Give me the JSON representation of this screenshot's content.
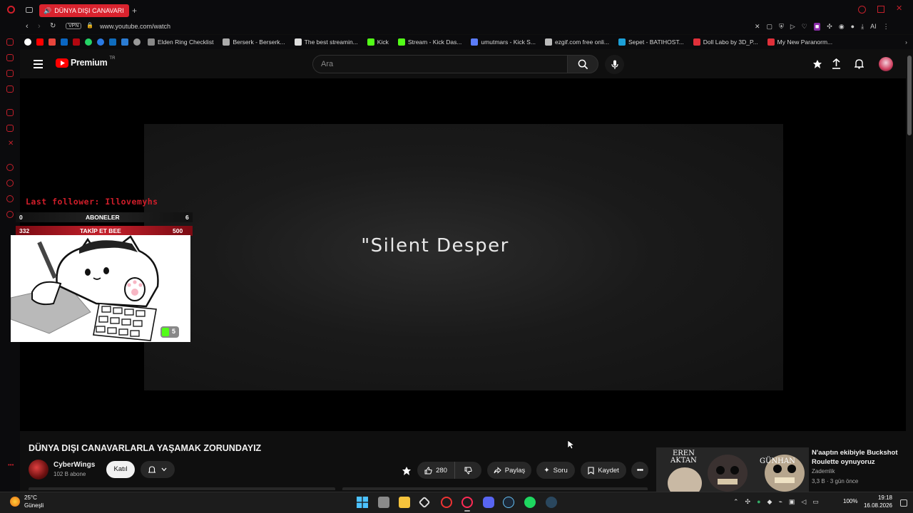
{
  "browser": {
    "tab_title": "DÜNYA DIŞI CANAVARI",
    "vpn_label": "VPN",
    "url": "www.youtube.com/watch",
    "ai_label": "AI",
    "bookmarks": [
      {
        "label": "Elden Ring Checklist",
        "color": "#888888"
      },
      {
        "label": "Berserk - Berserk...",
        "color": "#aaaaaa"
      },
      {
        "label": "The best streamin...",
        "color": "#dddddd"
      },
      {
        "label": "Kick",
        "color": "#53fc18"
      },
      {
        "label": "Stream - Kick Das...",
        "color": "#53fc18"
      },
      {
        "label": "umutmars - Kick S...",
        "color": "#5b7cfa"
      },
      {
        "label": "ezgif.com free onli...",
        "color": "#bbbbbb"
      },
      {
        "label": "Sepet - BATIHOST...",
        "color": "#1ca0d8"
      },
      {
        "label": "Doll Labo by 3D_P...",
        "color": "#e0303a"
      },
      {
        "label": "My New Paranorm...",
        "color": "#e0303a"
      }
    ]
  },
  "youtube": {
    "logo_text": "Premium",
    "logo_region": "TR",
    "search_placeholder": "Ara"
  },
  "video": {
    "subtitle_text": "\"Silent Desper",
    "overlay": {
      "last_follower": "Last follower: Illovemyhs",
      "row1": {
        "left": "0",
        "label": "ABONELER",
        "right": "6"
      },
      "row2": {
        "left": "332",
        "label": "TAKİP ET BEE",
        "right": "500"
      },
      "kick_count": "5"
    }
  },
  "info": {
    "title": "DÜNYA DIŞI CANAVARLARLA YAŞAMAK ZORUNDAYIZ",
    "channel_name": "CyberWings",
    "channel_subs": "102 B abone",
    "join_label": "Katıl",
    "likes": "280",
    "share_label": "Paylaş",
    "ask_label": "Soru",
    "save_label": "Kaydet"
  },
  "recommendation": {
    "thumb_left_text": "EREN\nAKTAN",
    "thumb_right_text": "GÜNHAN",
    "title": "N'aaptın ekibiyle Buckshot Roulette oynuyoruz",
    "channel": "Zademlik",
    "meta": "3,3 B · 3 gün önce"
  },
  "taskbar": {
    "temperature": "25°C",
    "weather": "Güneşli",
    "battery": "100%",
    "time": "19:18",
    "date": "16.08.2026"
  },
  "colors": {
    "accent": "#d9232e",
    "youtube_red": "#ff0000",
    "background": "#0f0f0f"
  }
}
